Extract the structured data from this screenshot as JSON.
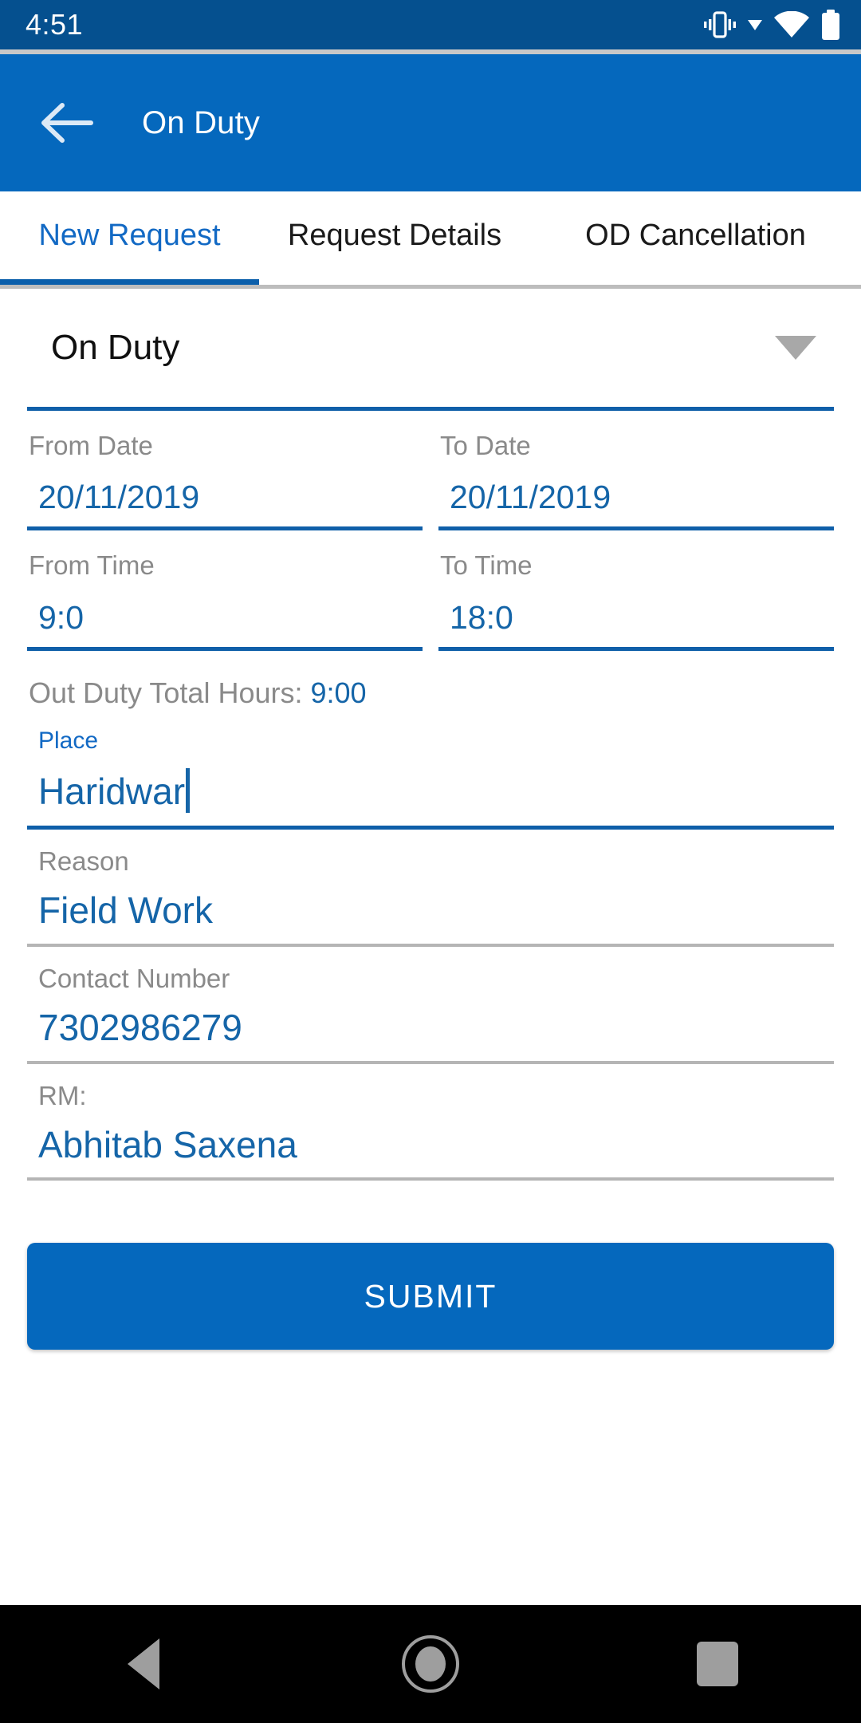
{
  "status_bar": {
    "clock": "4:51",
    "icons": [
      "vibrate-icon",
      "dropdown-caret-icon",
      "wifi-icon",
      "battery-icon"
    ],
    "background": "#05508f"
  },
  "app_bar": {
    "back_icon": "arrow-left-icon",
    "title": "On Duty",
    "background": "#0568bd"
  },
  "tabs": {
    "active_index": 0,
    "items": [
      {
        "label": "New Request"
      },
      {
        "label": "Request Details"
      },
      {
        "label": "OD Cancellation"
      }
    ],
    "active_color": "#1269c4",
    "inactive_color": "#1a1a1a",
    "indicator_color": "#0b5fab"
  },
  "form": {
    "type_select": {
      "value": "On Duty",
      "caret_icon": "triangle-down-icon"
    },
    "from_date": {
      "label": "From Date",
      "value": "20/11/2019"
    },
    "to_date": {
      "label": "To Date",
      "value": "20/11/2019"
    },
    "from_time": {
      "label": "From Time",
      "value": "9:0"
    },
    "to_time": {
      "label": "To Time",
      "value": "18:0"
    },
    "total_hours": {
      "label": "Out Duty Total Hours:",
      "value": "9:00"
    },
    "place": {
      "label": "Place",
      "value": "Haridwar",
      "focused": true
    },
    "reason": {
      "label": "Reason",
      "value": "Field Work"
    },
    "contact_number": {
      "label": "Contact Number",
      "value": "7302986279"
    },
    "rm": {
      "label": "RM:",
      "value": "Abhitab Saxena"
    },
    "submit": {
      "label": "SUBMIT",
      "color": "#0568bd"
    }
  },
  "nav_bar": {
    "back": "triangle-back-icon",
    "home": "circle-home-icon",
    "recents": "square-recents-icon"
  },
  "colors": {
    "value_text": "#1565a8",
    "label_text": "#8a8a8a",
    "underline_active": "#0f5fa9",
    "underline_inactive": "#b5b5b5"
  }
}
